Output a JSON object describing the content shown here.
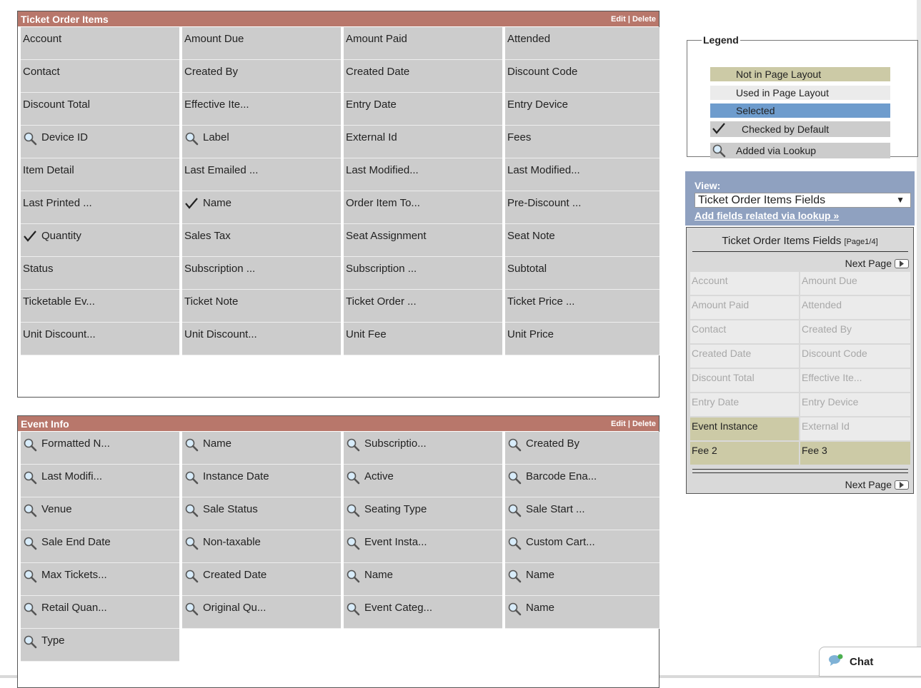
{
  "ticket_section": {
    "title": "Ticket Order Items",
    "edit": "Edit",
    "sep": " | ",
    "delete": "Delete",
    "fields": [
      {
        "label": "Account",
        "icon": ""
      },
      {
        "label": "Amount Due",
        "icon": ""
      },
      {
        "label": "Amount Paid",
        "icon": ""
      },
      {
        "label": "Attended",
        "icon": ""
      },
      {
        "label": "Contact",
        "icon": ""
      },
      {
        "label": "Created By",
        "icon": ""
      },
      {
        "label": "Created Date",
        "icon": ""
      },
      {
        "label": "Discount Code",
        "icon": ""
      },
      {
        "label": "Discount Total",
        "icon": ""
      },
      {
        "label": "Effective Ite...",
        "icon": ""
      },
      {
        "label": "Entry Date",
        "icon": ""
      },
      {
        "label": "Entry Device",
        "icon": ""
      },
      {
        "label": "Device ID",
        "icon": "lookup"
      },
      {
        "label": "Label",
        "icon": "lookup"
      },
      {
        "label": "External Id",
        "icon": ""
      },
      {
        "label": "Fees",
        "icon": ""
      },
      {
        "label": "Item Detail",
        "icon": ""
      },
      {
        "label": "Last Emailed ...",
        "icon": ""
      },
      {
        "label": "Last Modified...",
        "icon": ""
      },
      {
        "label": "Last Modified...",
        "icon": ""
      },
      {
        "label": "Last Printed ...",
        "icon": ""
      },
      {
        "label": "Name",
        "icon": "check"
      },
      {
        "label": "Order Item To...",
        "icon": ""
      },
      {
        "label": "Pre-Discount ...",
        "icon": ""
      },
      {
        "label": "Quantity",
        "icon": "check"
      },
      {
        "label": "Sales Tax",
        "icon": ""
      },
      {
        "label": "Seat Assignment",
        "icon": ""
      },
      {
        "label": "Seat Note",
        "icon": ""
      },
      {
        "label": "Status",
        "icon": ""
      },
      {
        "label": "Subscription ...",
        "icon": ""
      },
      {
        "label": "Subscription ...",
        "icon": ""
      },
      {
        "label": "Subtotal",
        "icon": ""
      },
      {
        "label": "Ticketable Ev...",
        "icon": ""
      },
      {
        "label": "Ticket Note",
        "icon": ""
      },
      {
        "label": "Ticket Order ...",
        "icon": ""
      },
      {
        "label": "Ticket Price ...",
        "icon": ""
      },
      {
        "label": "Unit Discount...",
        "icon": ""
      },
      {
        "label": "Unit Discount...",
        "icon": ""
      },
      {
        "label": "Unit Fee",
        "icon": ""
      },
      {
        "label": "Unit Price",
        "icon": ""
      }
    ]
  },
  "event_section": {
    "title": "Event Info",
    "edit": "Edit",
    "sep": " | ",
    "delete": "Delete",
    "fields": [
      {
        "label": "Formatted N...",
        "icon": "lookup"
      },
      {
        "label": "Name",
        "icon": "lookup"
      },
      {
        "label": "Subscriptio...",
        "icon": "lookup"
      },
      {
        "label": "Created By",
        "icon": "lookup"
      },
      {
        "label": "Last Modifi...",
        "icon": "lookup"
      },
      {
        "label": "Instance Date",
        "icon": "lookup"
      },
      {
        "label": "Active",
        "icon": "lookup"
      },
      {
        "label": "Barcode Ena...",
        "icon": "lookup"
      },
      {
        "label": "Venue",
        "icon": "lookup"
      },
      {
        "label": "Sale Status",
        "icon": "lookup"
      },
      {
        "label": "Seating Type",
        "icon": "lookup"
      },
      {
        "label": "Sale Start ...",
        "icon": "lookup"
      },
      {
        "label": "Sale End Date",
        "icon": "lookup"
      },
      {
        "label": "Non-taxable",
        "icon": "lookup"
      },
      {
        "label": "Event Insta...",
        "icon": "lookup"
      },
      {
        "label": "Custom Cart...",
        "icon": "lookup"
      },
      {
        "label": "Max Tickets...",
        "icon": "lookup"
      },
      {
        "label": "Created Date",
        "icon": "lookup"
      },
      {
        "label": "Name",
        "icon": "lookup"
      },
      {
        "label": "Name",
        "icon": "lookup"
      },
      {
        "label": "Retail Quan...",
        "icon": "lookup"
      },
      {
        "label": "Original Qu...",
        "icon": "lookup"
      },
      {
        "label": "Event Categ...",
        "icon": "lookup"
      },
      {
        "label": "Name",
        "icon": "lookup"
      },
      {
        "label": "Type",
        "icon": "lookup"
      }
    ]
  },
  "legend": {
    "title": "Legend",
    "items": [
      {
        "label": "Not in Page Layout",
        "color": "#cccaa6",
        "icon": ""
      },
      {
        "label": "Used in Page Layout",
        "color": "#ebebeb",
        "icon": ""
      },
      {
        "label": "Selected",
        "color": "#6e9ccd",
        "icon": ""
      },
      {
        "label": "Checked by Default",
        "color": "#cccccc",
        "icon": "check"
      },
      {
        "label": "Added via Lookup",
        "color": "#cccccc",
        "icon": "lookup"
      }
    ]
  },
  "view": {
    "label": "View:",
    "selected": "Ticket Order Items Fields",
    "link": "Add fields related via lookup »"
  },
  "palette": {
    "title": "Ticket Order Items Fields ",
    "page": "[Page1/4]",
    "next_label": "Next Page",
    "fields": [
      {
        "label": "Account",
        "state": "used"
      },
      {
        "label": "Amount Due",
        "state": "used"
      },
      {
        "label": "Amount Paid",
        "state": "used"
      },
      {
        "label": "Attended",
        "state": "used"
      },
      {
        "label": "Contact",
        "state": "used"
      },
      {
        "label": "Created By",
        "state": "used"
      },
      {
        "label": "Created Date",
        "state": "used"
      },
      {
        "label": "Discount Code",
        "state": "used"
      },
      {
        "label": "Discount Total",
        "state": "used"
      },
      {
        "label": "Effective Ite...",
        "state": "used"
      },
      {
        "label": "Entry Date",
        "state": "used"
      },
      {
        "label": "Entry Device",
        "state": "used"
      },
      {
        "label": "Event Instance",
        "state": "not_in_layout"
      },
      {
        "label": "External Id",
        "state": "used"
      },
      {
        "label": "Fee 2",
        "state": "not_in_layout"
      },
      {
        "label": "Fee 3",
        "state": "not_in_layout"
      }
    ]
  },
  "chat": {
    "label": "Chat"
  }
}
